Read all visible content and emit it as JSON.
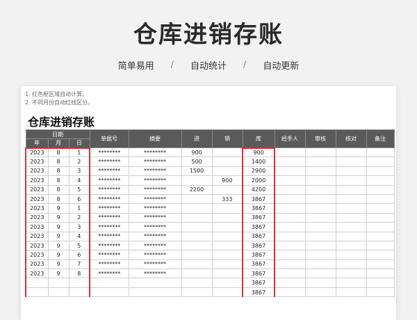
{
  "hero": {
    "title": "仓库进销存账",
    "features": [
      "简单易用",
      "自动统计",
      "自动更新"
    ],
    "separator": "/"
  },
  "sheet": {
    "notes": [
      "1. 红色框区域自动计算。",
      "2. 不同月份自动红线区分。"
    ],
    "title": "仓库进销存账",
    "headers": {
      "date_group": "日期",
      "year": "年",
      "month": "月",
      "day": "日",
      "voucher": "单据号",
      "summary": "摘要",
      "in": "进",
      "out": "销",
      "stock": "库",
      "handler": "经手人",
      "review": "审核",
      "check": "核对",
      "remark": "备注"
    },
    "rows": [
      {
        "year": "2023",
        "month": "8",
        "day": "1",
        "voucher": "********",
        "summary": "********",
        "in": "900",
        "out": "",
        "stock": "900"
      },
      {
        "year": "2023",
        "month": "8",
        "day": "2",
        "voucher": "********",
        "summary": "********",
        "in": "500",
        "out": "",
        "stock": "1400"
      },
      {
        "year": "2023",
        "month": "8",
        "day": "3",
        "voucher": "********",
        "summary": "********",
        "in": "1500",
        "out": "",
        "stock": "2900"
      },
      {
        "year": "2023",
        "month": "8",
        "day": "4",
        "voucher": "********",
        "summary": "********",
        "in": "",
        "out": "900",
        "stock": "2000"
      },
      {
        "year": "2023",
        "month": "8",
        "day": "5",
        "voucher": "********",
        "summary": "********",
        "in": "2200",
        "out": "",
        "stock": "4200"
      },
      {
        "year": "2023",
        "month": "8",
        "day": "6",
        "voucher": "********",
        "summary": "********",
        "in": "",
        "out": "333",
        "stock": "3867"
      },
      {
        "year": "2023",
        "month": "9",
        "day": "1",
        "voucher": "********",
        "summary": "********",
        "in": "",
        "out": "",
        "stock": "3867"
      },
      {
        "year": "2023",
        "month": "9",
        "day": "2",
        "voucher": "********",
        "summary": "********",
        "in": "",
        "out": "",
        "stock": "3867"
      },
      {
        "year": "2023",
        "month": "9",
        "day": "3",
        "voucher": "********",
        "summary": "********",
        "in": "",
        "out": "",
        "stock": "3867"
      },
      {
        "year": "2023",
        "month": "9",
        "day": "4",
        "voucher": "********",
        "summary": "********",
        "in": "",
        "out": "",
        "stock": "3867"
      },
      {
        "year": "2023",
        "month": "9",
        "day": "5",
        "voucher": "********",
        "summary": "********",
        "in": "",
        "out": "",
        "stock": "3867"
      },
      {
        "year": "2023",
        "month": "9",
        "day": "6",
        "voucher": "********",
        "summary": "********",
        "in": "",
        "out": "",
        "stock": "3867"
      },
      {
        "year": "2023",
        "month": "9",
        "day": "7",
        "voucher": "********",
        "summary": "********",
        "in": "",
        "out": "",
        "stock": "3867"
      },
      {
        "year": "2023",
        "month": "9",
        "day": "8",
        "voucher": "********",
        "summary": "********",
        "in": "",
        "out": "",
        "stock": "3867"
      },
      {
        "year": "",
        "month": "",
        "day": "",
        "voucher": "",
        "summary": "",
        "in": "",
        "out": "",
        "stock": "3867"
      },
      {
        "year": "",
        "month": "",
        "day": "",
        "voucher": "",
        "summary": "",
        "in": "",
        "out": "",
        "stock": "3867"
      }
    ],
    "accent_color": "#d9302c",
    "header_color": "#5a5a5a"
  }
}
